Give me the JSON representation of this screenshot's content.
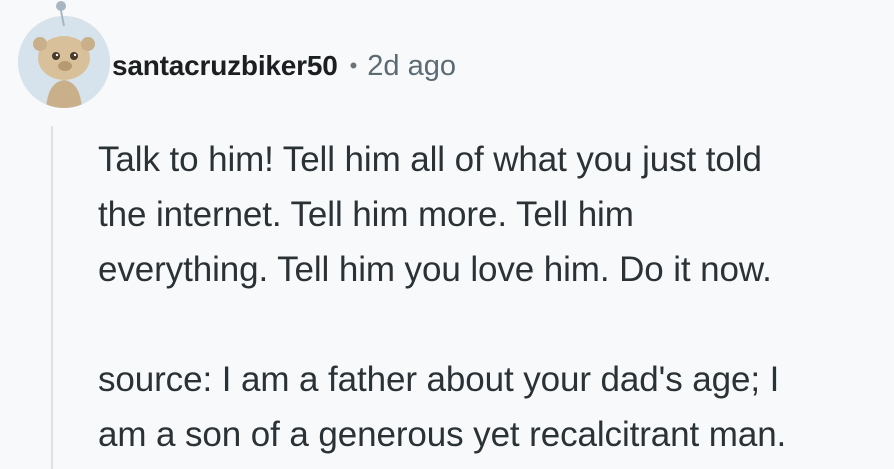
{
  "comment": {
    "author": "santacruzbiker50",
    "separator": "•",
    "timestamp": "2d ago",
    "avatar_icon": "snoo-avatar-icon",
    "paragraphs": [
      {
        "lines": [
          "Talk to him! Tell him all of what you just told",
          "the internet. Tell him more. Tell him",
          "everything. Tell him you love him. Do it now."
        ]
      },
      {
        "lines": [
          "source: I am a father about your dad's age; I",
          "am a son of a generous yet recalcitrant man."
        ]
      }
    ]
  },
  "colors": {
    "background": "#f8f9fa",
    "text": "#2a3236",
    "username": "#1c1f21",
    "meta": "#5c6a72",
    "thread_line": "#dde2e5",
    "avatar_bg": "#d7e3ec"
  }
}
